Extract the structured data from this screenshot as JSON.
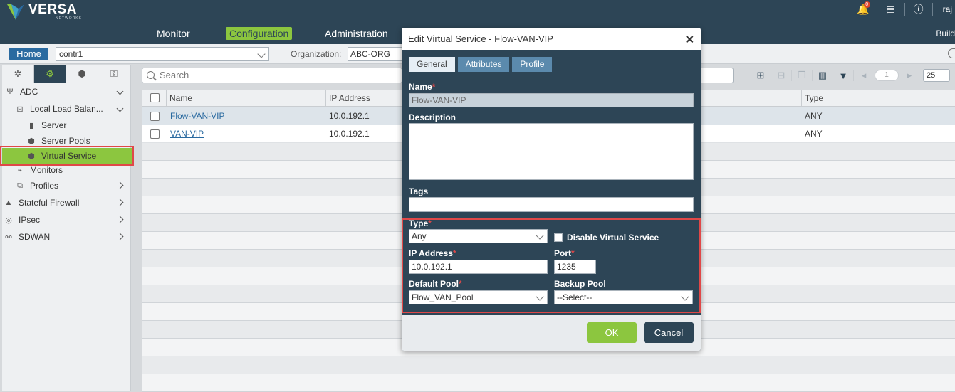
{
  "brand": {
    "name": "VERSA",
    "sub": "NETWORKS"
  },
  "header": {
    "nav": [
      "Monitor",
      "Configuration",
      "Administration"
    ],
    "active_nav": "Configuration",
    "notification_count": "0",
    "user": "raj",
    "build_label": "Build"
  },
  "context": {
    "home_label": "Home",
    "tenant": "contr1",
    "org_label": "Organization:",
    "org_value": "ABC-ORG"
  },
  "sidebar": {
    "items": [
      {
        "label": "ADC"
      },
      {
        "label": "Local Load Balan..."
      },
      {
        "label": "Server"
      },
      {
        "label": "Server Pools"
      },
      {
        "label": "Virtual Service"
      },
      {
        "label": "Monitors"
      },
      {
        "label": "Profiles"
      },
      {
        "label": "Stateful Firewall"
      },
      {
        "label": "IPsec"
      },
      {
        "label": "SDWAN"
      }
    ]
  },
  "toolbar": {
    "search_placeholder": "Search",
    "page": "1",
    "page_size": "25"
  },
  "table": {
    "columns": [
      "Name",
      "IP Address",
      "Type"
    ],
    "rows": [
      {
        "name": "Flow-VAN-VIP",
        "ip": "10.0.192.1",
        "type": "ANY"
      },
      {
        "name": "VAN-VIP",
        "ip": "10.0.192.1",
        "type": "ANY"
      }
    ]
  },
  "modal": {
    "title": "Edit Virtual Service - Flow-VAN-VIP",
    "tabs": [
      "General",
      "Attributes",
      "Profile"
    ],
    "name_label": "Name",
    "name_value": "Flow-VAN-VIP",
    "description_label": "Description",
    "description_value": "",
    "tags_label": "Tags",
    "tags_value": "",
    "type_label": "Type",
    "type_value": "Any",
    "disable_label": "Disable Virtual Service",
    "ip_label": "IP Address",
    "ip_value": "10.0.192.1",
    "port_label": "Port",
    "port_value": "1235",
    "default_pool_label": "Default Pool",
    "default_pool_value": "Flow_VAN_Pool",
    "backup_pool_label": "Backup Pool",
    "backup_pool_value": "--Select--",
    "ok_label": "OK",
    "cancel_label": "Cancel"
  },
  "colors": {
    "header": "#2d4556",
    "accent": "#8cc63f",
    "link": "#2a6aa0",
    "highlight": "#e04848"
  }
}
